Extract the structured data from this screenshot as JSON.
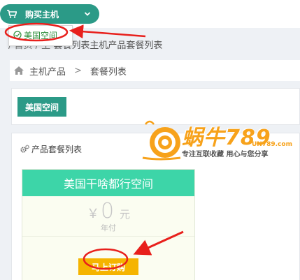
{
  "topbar": {
    "buy_host_label": "购买主机",
    "buy_host_icon": "cart-icon",
    "caret_icon": "chevron-down-icon",
    "dropdown_items": [
      {
        "label": "美国空间",
        "icon": "check-circle-icon"
      }
    ]
  },
  "page_title": {
    "prefix": "/ 首页 / 主",
    "text": "套餐列表主机产品套餐列表"
  },
  "breadcrumb": {
    "home_icon": "home-icon",
    "items": [
      "主机产品",
      "套餐列表"
    ],
    "separator": ">"
  },
  "category": {
    "button_label": "美国空间"
  },
  "product_list": {
    "header_icon": "gear-icon",
    "header_label": "产品套餐列表",
    "plans": [
      {
        "title": "美国干啥都行空间",
        "currency": "￥",
        "price": "0",
        "unit": "元",
        "period": "年付",
        "order_label": "马上订购"
      }
    ]
  },
  "watermark": {
    "brand": "蜗牛789",
    "site": "UN789.com",
    "slogan": "专注互联收藏  用心与您分享"
  },
  "colors": {
    "primary": "#2b9a87",
    "plan_header": "#3dd5a8",
    "order_button": "#f5b400",
    "annotation": "#e8201c",
    "watermark": "#f7a21b"
  }
}
